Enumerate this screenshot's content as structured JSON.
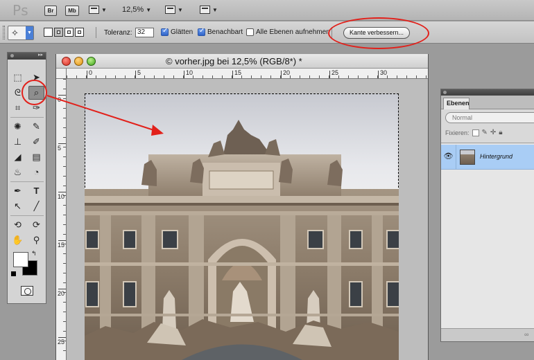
{
  "app": {
    "logo": "Ps",
    "bridge_label": "Br",
    "minibridge_label": "Mb",
    "zoom_value": "12,5%"
  },
  "options": {
    "tolerance_label": "Toleranz:",
    "tolerance_value": "32",
    "antialias_label": "Glätten",
    "antialias_checked": true,
    "contiguous_label": "Benachbart",
    "contiguous_checked": true,
    "all_layers_label": "Alle Ebenen aufnehmen",
    "all_layers_checked": false,
    "refine_edge_label": "Kante verbessern..."
  },
  "toolbox": {
    "selected_tool": "quick-selection-tool"
  },
  "document": {
    "title": "© vorher.jpg bei 12,5% (RGB/8*) *",
    "ruler_h_labels": [
      "0",
      "5",
      "10",
      "15",
      "20",
      "25",
      "30"
    ],
    "ruler_v_labels": [
      "0",
      "5",
      "10",
      "15",
      "20",
      "25"
    ]
  },
  "layers": {
    "tab_label": "Ebenen",
    "blend_mode": "Normal",
    "lock_label": "Fixieren:",
    "layer_items": [
      {
        "name": "Hintergrund",
        "visible": true,
        "selected": true
      }
    ]
  },
  "colors": {
    "annotation": "#e2201a",
    "selected_layer": "#a9cdf5",
    "checkbox_on": "#2f63c8"
  },
  "icons": {
    "tool_preset": "magic-wand-icon",
    "eye": "eye-icon",
    "link": "link-icon"
  }
}
